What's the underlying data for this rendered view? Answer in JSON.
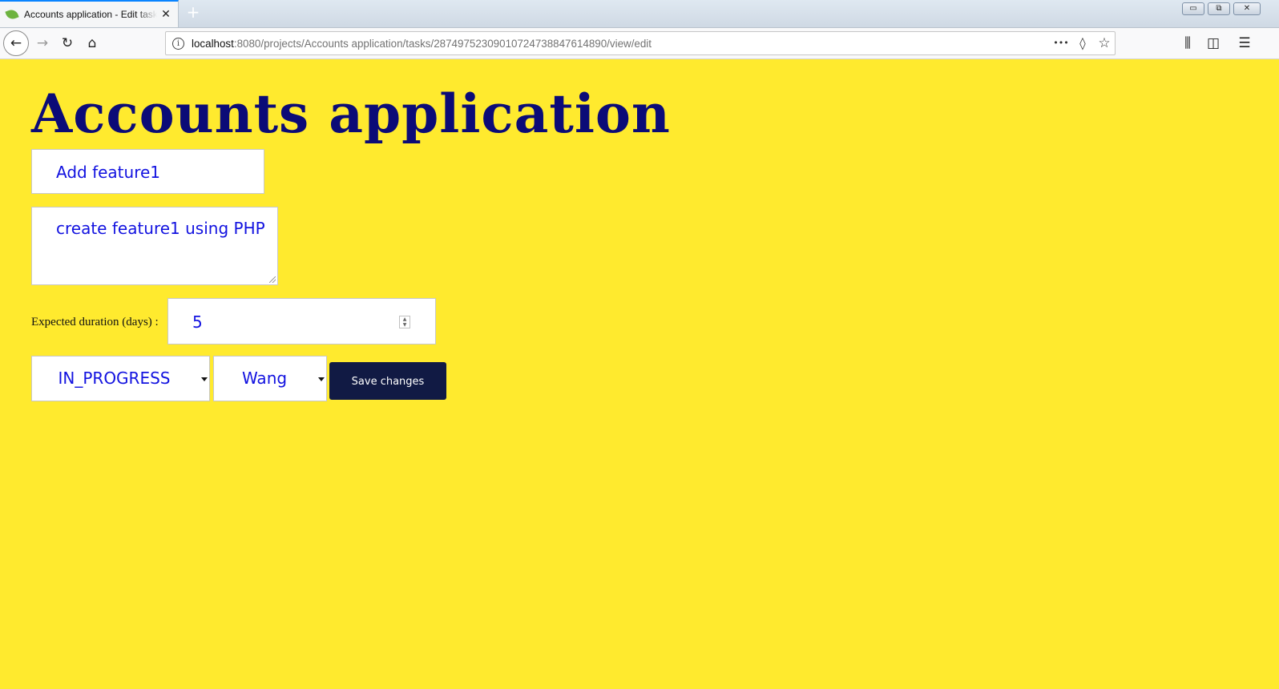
{
  "browser": {
    "tab_title": "Accounts application - Edit task",
    "tab_close": "✕",
    "new_tab": "+",
    "url_host": "localhost",
    "url_rest": ":8080/projects/Accounts application/tasks/287497523090107247388476148​90/view/edit",
    "nav_icons": {
      "back": "←",
      "forward": "→",
      "reload": "↻",
      "home": "⌂",
      "page_actions": "•••",
      "pocket": "◊",
      "bookmark": "☆",
      "library": "⫼",
      "sidebar": "◫",
      "menu": "☰"
    },
    "window_buttons": {
      "minimize": "▭",
      "restore": "⧉",
      "close": "✕"
    }
  },
  "page": {
    "title": "Accounts application",
    "task_name": "Add feature1",
    "task_description": "create feature1 using PHP",
    "duration_label": "Expected duration (days) :",
    "duration_value": "5",
    "status_value": "IN_PROGRESS",
    "assignee_value": "Wang",
    "save_label": "Save changes"
  },
  "colors": {
    "background": "#ffea2e",
    "title": "#0b0b77",
    "field_text": "#1212e0",
    "button": "#111a44"
  }
}
